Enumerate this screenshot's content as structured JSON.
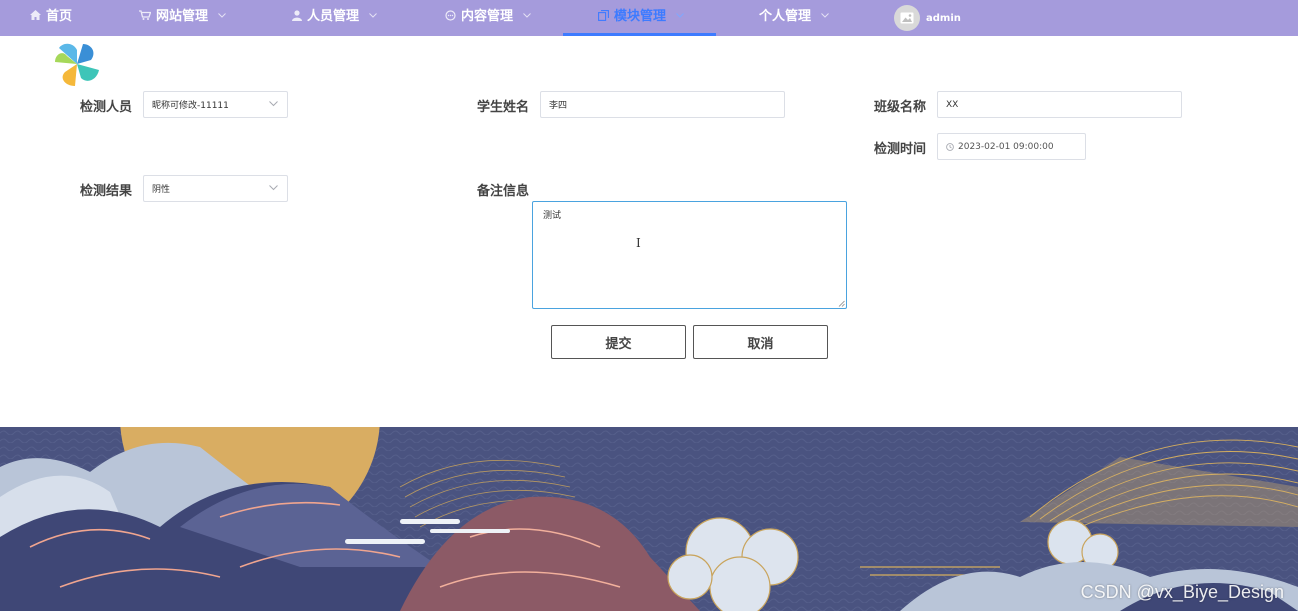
{
  "nav": {
    "items": [
      {
        "label": "首页",
        "icon": "home-icon"
      },
      {
        "label": "网站管理",
        "icon": "cart-icon"
      },
      {
        "label": "人员管理",
        "icon": "user-icon"
      },
      {
        "label": "内容管理",
        "icon": "chat-icon"
      },
      {
        "label": "模块管理",
        "icon": "copy-icon",
        "active": true
      },
      {
        "label": "个人管理"
      }
    ],
    "user": "admin"
  },
  "form": {
    "inspector_label": "检测人员",
    "inspector_value": "昵称可修改-11111",
    "student_label": "学生姓名",
    "student_value": "李四",
    "class_label": "班级名称",
    "class_value": "XX",
    "time_label": "检测时间",
    "time_value": "2023-02-01 09:00:00",
    "result_label": "检测结果",
    "result_value": "阴性",
    "remark_label": "备注信息",
    "remark_value": "测试",
    "submit_label": "提交",
    "cancel_label": "取消"
  },
  "watermark": "CSDN @vx_Biye_Design",
  "colors": {
    "nav_bg": "#a59bdc",
    "nav_active": "#3d7bff",
    "textarea_focus": "#4aa3df"
  }
}
